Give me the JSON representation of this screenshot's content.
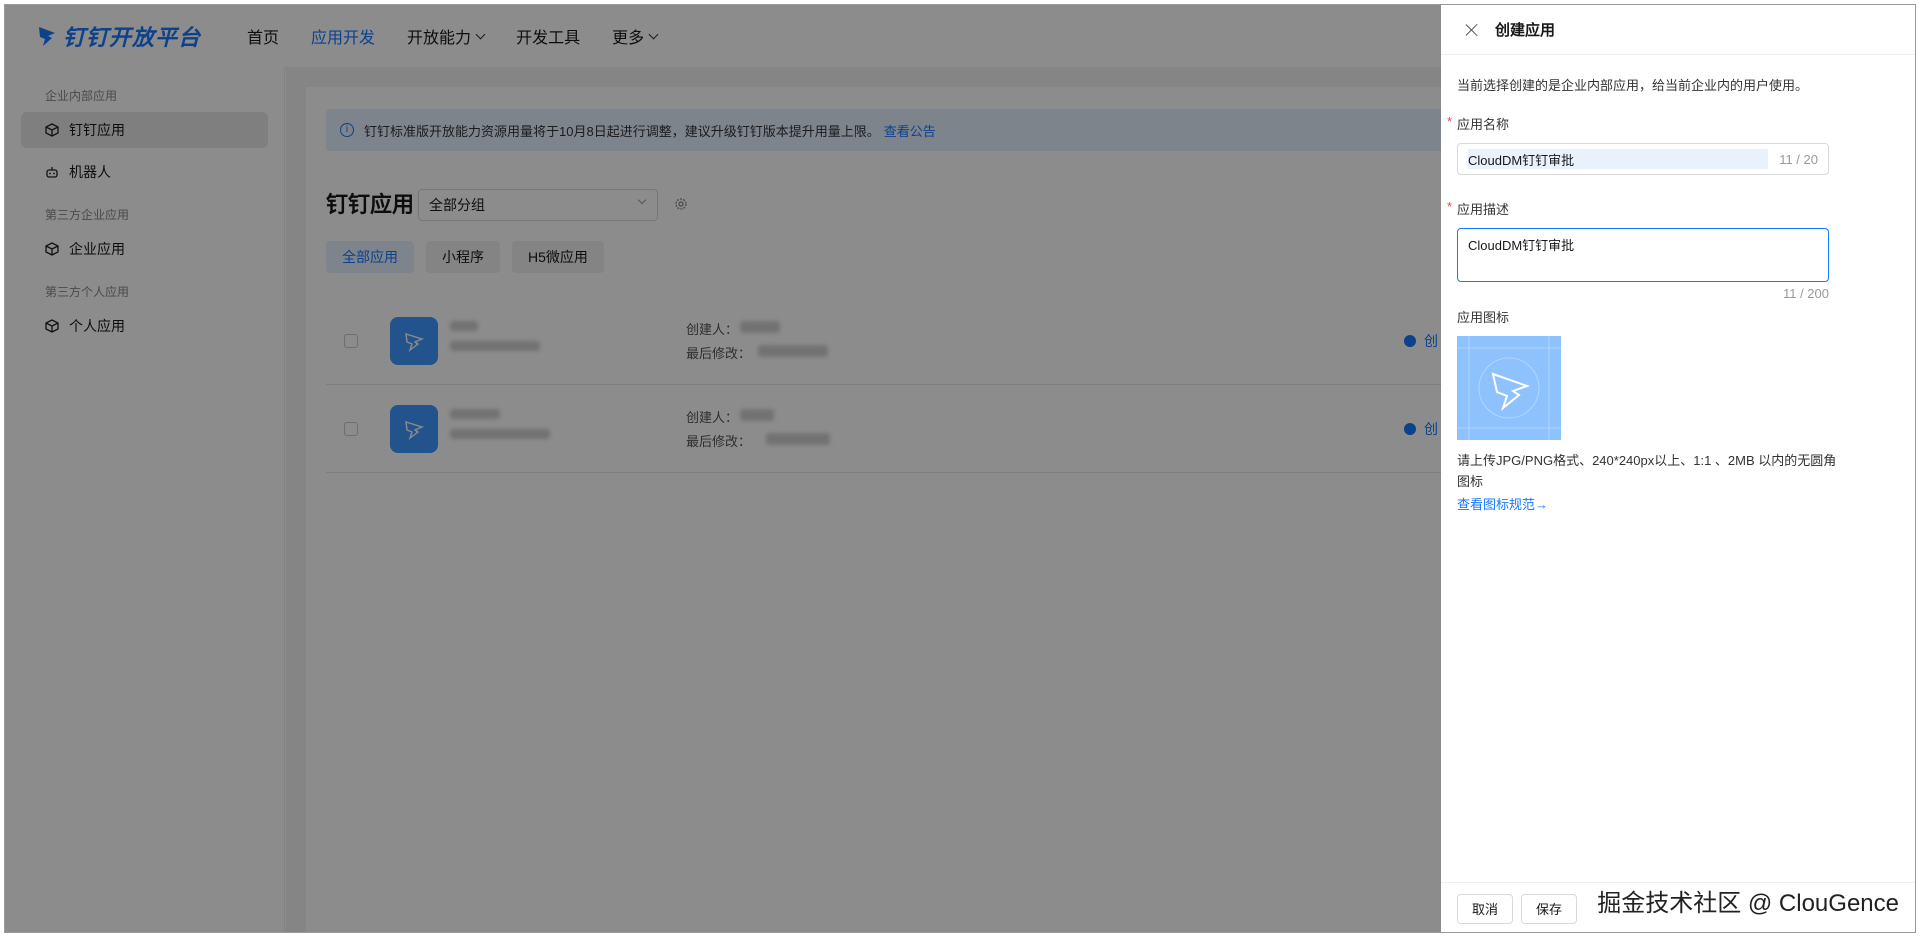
{
  "nav": {
    "logo": "钉钉开放平台",
    "items": [
      "首页",
      "应用开发",
      "开放能力",
      "开发工具",
      "更多"
    ]
  },
  "sidebar": {
    "group1": "企业内部应用",
    "item_dingapp": "钉钉应用",
    "item_robot": "机器人",
    "group2": "第三方企业应用",
    "item_enterprise": "企业应用",
    "group3": "第三方个人应用",
    "item_personal": "个人应用"
  },
  "main": {
    "notice_text": "钉钉标准版开放能力资源用量将于10月8日起进行调整，建议升级钉钉版本提升用量上限。",
    "notice_link": "查看公告",
    "title": "钉钉应用",
    "group_select": "全部分组",
    "filters": [
      "全部应用",
      "小程序",
      "H5微应用"
    ],
    "row_creator_label": "创建人：",
    "row_modified_label": "最后修改：",
    "row_action": "创"
  },
  "drawer": {
    "title": "创建应用",
    "hint": "当前选择创建的是企业内部应用，给当前企业内的用户使用。",
    "name_label": "应用名称",
    "name_value": "CloudDM钉钉审批",
    "name_count": "11 / 20",
    "desc_label": "应用描述",
    "desc_value": "CloudDM钉钉审批",
    "desc_count": "11 / 200",
    "icon_label": "应用图标",
    "upload_hint": "请上传JPG/PNG格式、240*240px以上、1:1 、2MB 以内的无圆角图标",
    "spec_link": "查看图标规范→",
    "cancel": "取消",
    "save": "保存",
    "required_mark": "*"
  },
  "watermark": "掘金技术社区 @ ClouGence",
  "colors": {
    "accent": "#1677ff",
    "overlay": "rgba(0,0,0,0.45)"
  }
}
